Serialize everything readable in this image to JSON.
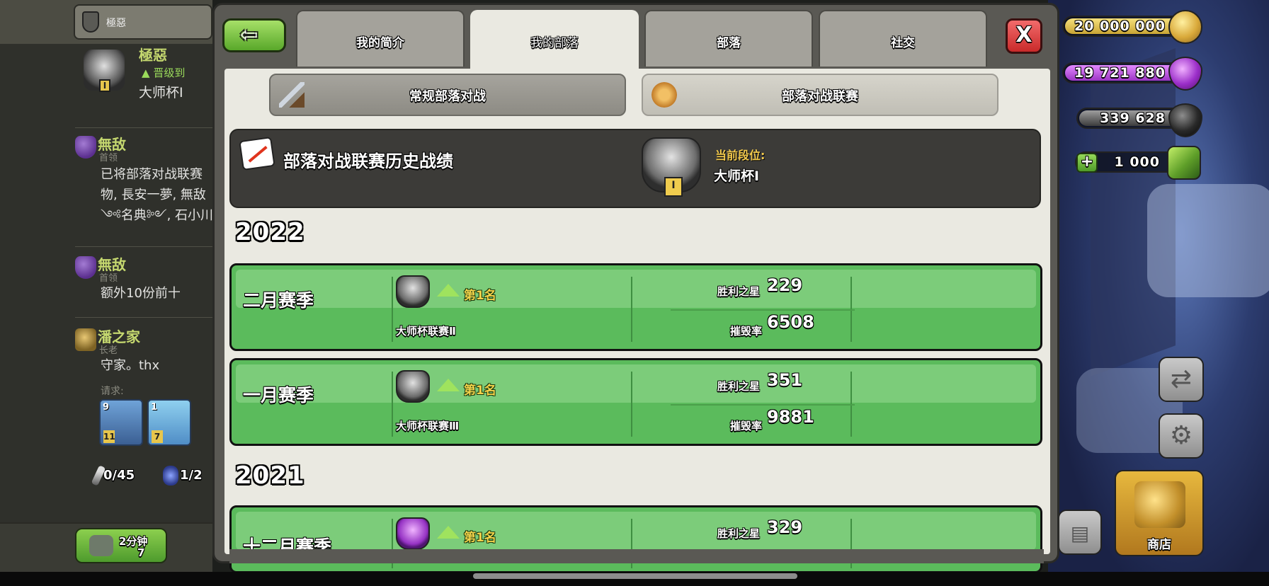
{
  "chat": {
    "clan_tab_name": "極惡",
    "first_message": {
      "name": "極惡",
      "promoted_text": "晋级到",
      "league": "大师杯Ⅰ",
      "level": "I"
    },
    "messages": [
      {
        "name": "無敌",
        "role": "首领",
        "lines": [
          "已将部落对战联赛",
          "物, 長安一夢, 無敌",
          "༺名典༻, 石小川"
        ]
      },
      {
        "name": "無敌",
        "role": "首领",
        "lines": [
          "额外10份前十"
        ]
      },
      {
        "name": "潘之家",
        "role": "长老",
        "lines": [
          "守家。thx"
        ]
      }
    ],
    "requests_label": "请求:",
    "request_cards": [
      {
        "level": "9",
        "count": "11"
      },
      {
        "level": "1",
        "count": "7"
      }
    ],
    "donated_troops": "0/45",
    "donated_spells": "1/2",
    "train_button": {
      "time": "2分钟",
      "gems": "7"
    }
  },
  "hud": {
    "gold": "20 000 000",
    "elixir": "19 721 880",
    "dark_elixir": "339 628",
    "gems": "1 000",
    "gems_plus": "+",
    "shop_label": "商店",
    "icons": {
      "trade": "trader-icon",
      "settings": "gear-icon",
      "layout": "layout-icon",
      "shop": "shop-hammer-icon"
    }
  },
  "modal": {
    "back_label": "⇦",
    "close_label": "X",
    "tabs": [
      {
        "label": "我的简介",
        "active": false
      },
      {
        "label": "我的部落",
        "active": true
      },
      {
        "label": "部落",
        "active": false
      },
      {
        "label": "社交",
        "active": false
      }
    ],
    "war_modes": [
      {
        "label": "常规部落对战",
        "active": false
      },
      {
        "label": "部落对战联赛",
        "active": true
      }
    ],
    "history": {
      "title": "部落对战联赛历史战绩",
      "current_league_label": "当前段位:",
      "current_league_value": "大师杯Ⅰ"
    },
    "years": [
      {
        "year": "2022",
        "seasons": [
          {
            "name": "二月赛季",
            "league": "大师杯联赛Ⅱ",
            "rank": "第1名",
            "stars_label": "胜利之星",
            "stars": "229",
            "destruction_label": "摧毁率",
            "destruction": "6508",
            "badge_level": "II"
          },
          {
            "name": "一月赛季",
            "league": "大师杯联赛Ⅲ",
            "rank": "第1名",
            "stars_label": "胜利之星",
            "stars": "351",
            "destruction_label": "摧毁率",
            "destruction": "9881",
            "badge_level": "III"
          }
        ]
      },
      {
        "year": "2021",
        "seasons": [
          {
            "name": "十二月赛季",
            "rank": "第1名",
            "stars_label": "胜利之星",
            "stars": "329"
          }
        ]
      }
    ]
  },
  "colors": {
    "season_green": "#5bbb5c",
    "season_band": "#7ccc7a",
    "rank_gold": "#f3d24a",
    "promo_green": "#9fe35e",
    "tab_active": "#eae9e1",
    "back_green": "#59a82a",
    "close_red": "#c92a2a"
  }
}
